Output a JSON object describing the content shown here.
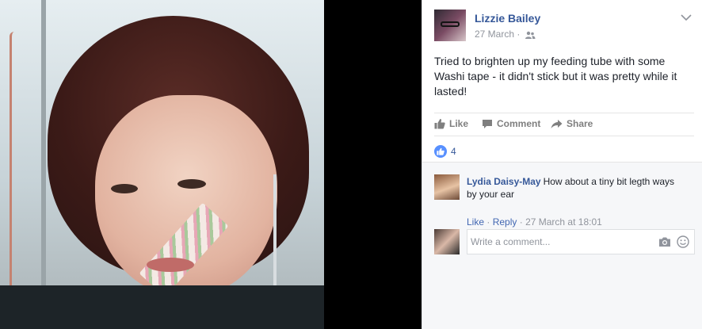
{
  "post": {
    "author": "Lizzie Bailey",
    "date": "27 March",
    "separator": "·",
    "audience_icon": "friends-icon",
    "text": "Tried to brighten up my feeding tube with some Washi tape - it didn't stick but it was pretty while it lasted!"
  },
  "actions": {
    "like": "Like",
    "comment": "Comment",
    "share": "Share"
  },
  "reactions": {
    "icon": "like-icon",
    "count": "4",
    "color": "#5890ff"
  },
  "comments": [
    {
      "author": "Lydia Daisy-May",
      "text": "How about a tiny bit legth ways by your ear",
      "like_label": "Like",
      "reply_label": "Reply",
      "separator": "·",
      "timestamp": "27 March at 18:01"
    }
  ],
  "composer": {
    "placeholder": "Write a comment...",
    "icons": [
      "camera-icon",
      "emoji-icon"
    ]
  },
  "colors": {
    "link": "#365899",
    "meta": "#90949c",
    "action": "#7f7f7f",
    "viewer_bg": "#000000"
  }
}
